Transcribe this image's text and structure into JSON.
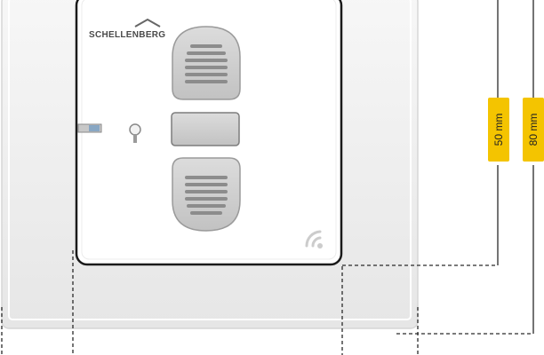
{
  "product": {
    "brand": "SCHELLENBERG",
    "buttons": [
      {
        "name": "up",
        "icon": "up-arrow-lines-icon"
      },
      {
        "name": "stop",
        "icon": "stop-rectangle-icon"
      },
      {
        "name": "down",
        "icon": "down-arrow-lines-icon"
      }
    ],
    "indicators": [
      "status-led-icon",
      "signal-wireless-icon",
      "battery-slot-icon"
    ]
  },
  "dimensions": {
    "inner_size": "50 mm",
    "outer_size": "80 mm"
  },
  "colors": {
    "label_background": "#f4c400",
    "frame_outer": "#eeeeee",
    "frame_inner": "#ffffff",
    "button_gray": "#cfcfcf",
    "dashed_line": "#2a2a2a"
  }
}
